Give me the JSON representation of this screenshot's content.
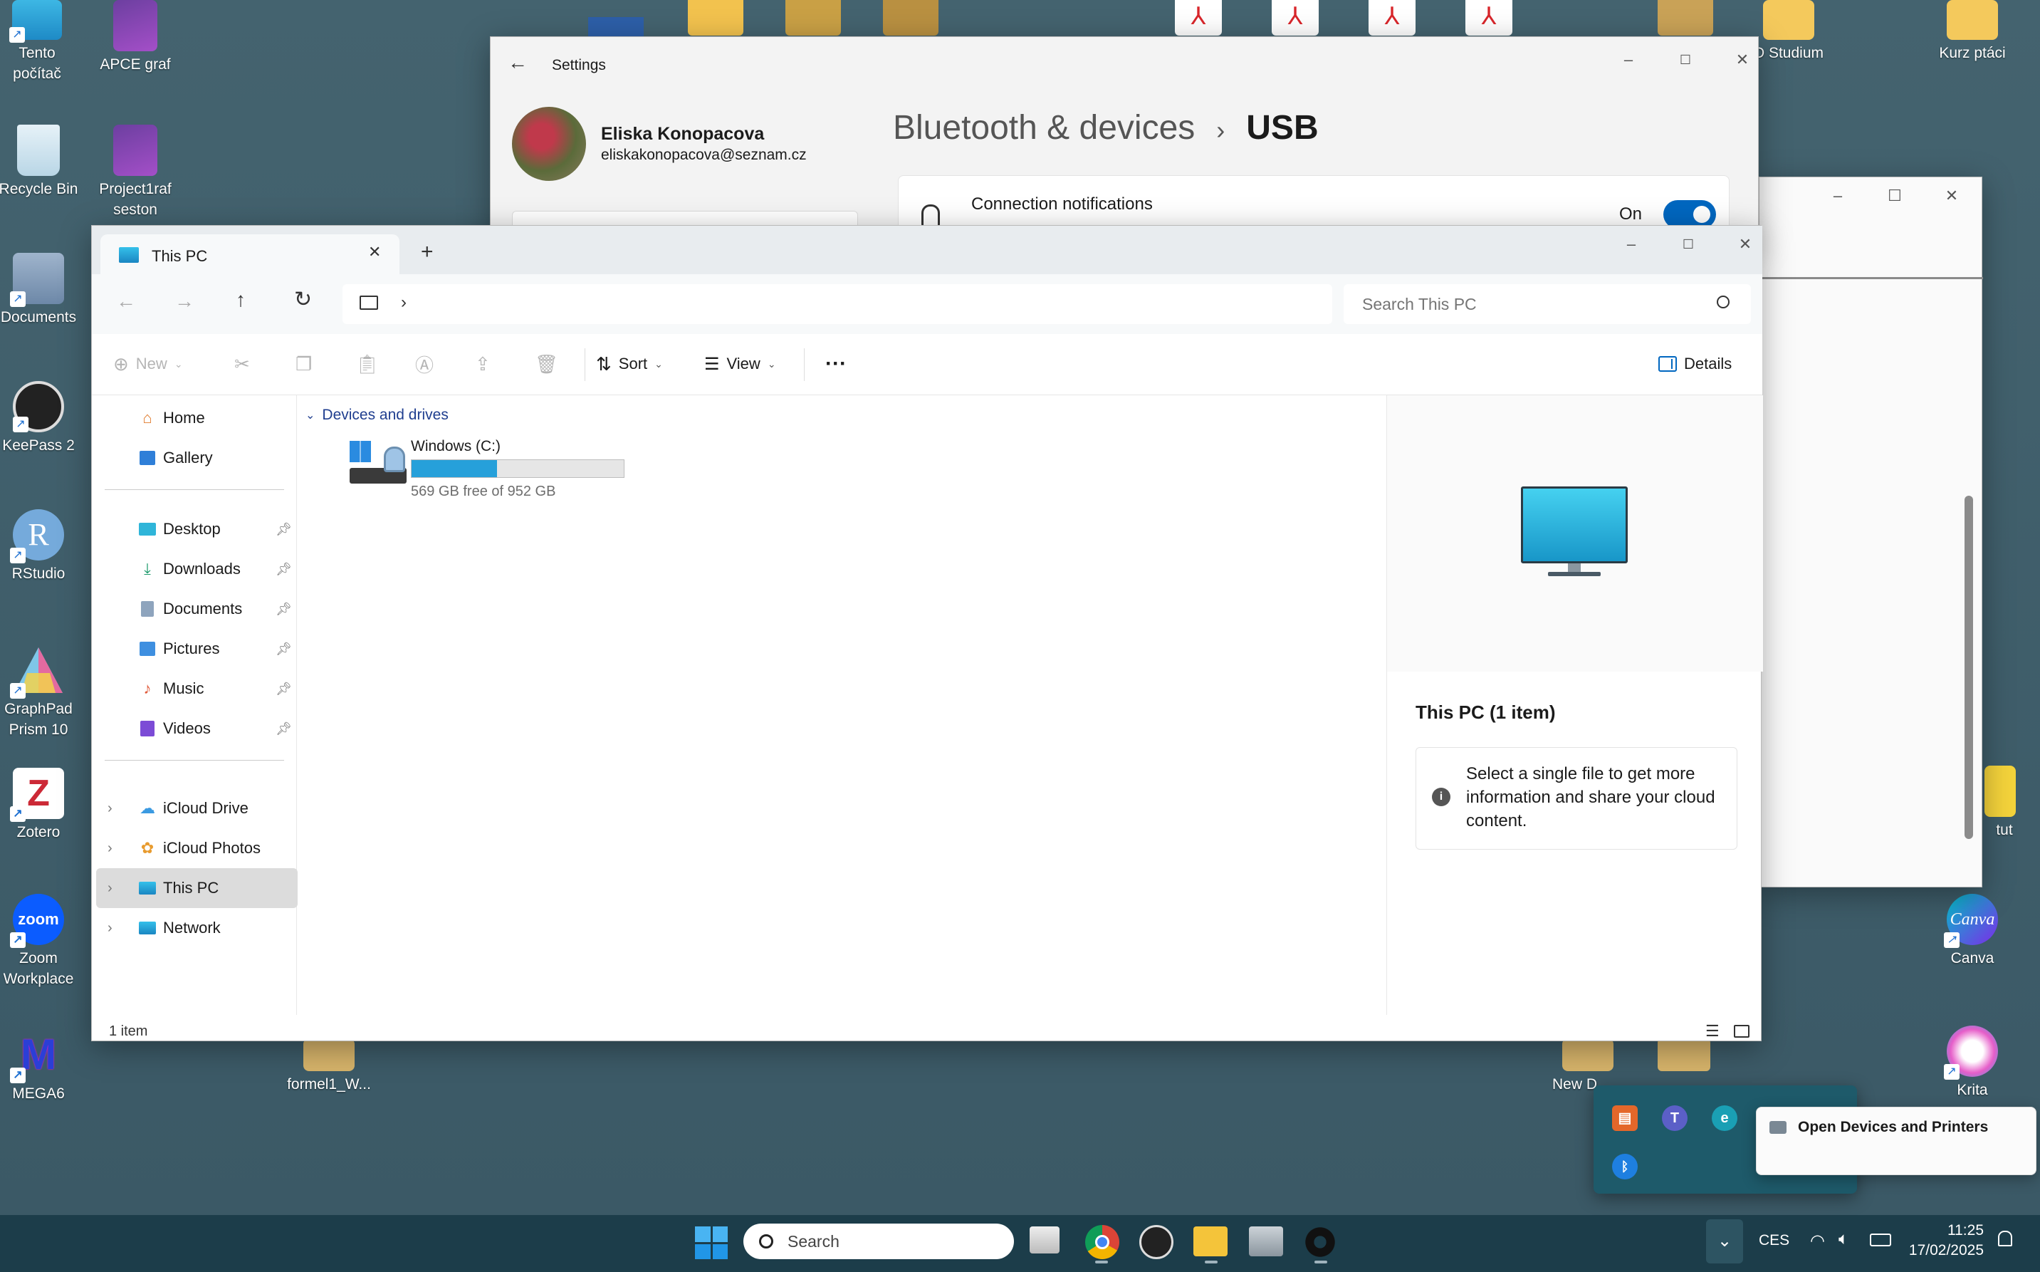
{
  "desktop": {
    "icons_left": [
      {
        "label": "Tento počítač",
        "icon": "this-pc-icon"
      },
      {
        "label": "APCE graf",
        "icon": "prism-file-icon"
      },
      {
        "label": "Recycle Bin",
        "icon": "recycle-bin-icon"
      },
      {
        "label": "Project1raf seston",
        "icon": "prism-file-icon"
      },
      {
        "label": "Documents",
        "icon": "documents-folder-icon"
      },
      {
        "label": "KeePass 2",
        "icon": "keepass-icon"
      },
      {
        "label": "RStudio",
        "icon": "rstudio-icon"
      },
      {
        "label": "GraphPad Prism 10",
        "icon": "prism-app-icon"
      },
      {
        "label": "Zotero",
        "icon": "zotero-icon"
      },
      {
        "label": "Zoom Workplace",
        "icon": "zoom-icon"
      },
      {
        "label": "MEGA6",
        "icon": "mega-icon"
      },
      {
        "label": "formel1_W...",
        "icon": "folder-icon"
      }
    ],
    "icons_right": [
      {
        "label": "D Studium",
        "icon": "folder-icon"
      },
      {
        "label": "Kurz ptáci",
        "icon": "folder-icon"
      },
      {
        "label": "Canva",
        "icon": "canva-icon"
      },
      {
        "label": "Krita",
        "icon": "krita-icon"
      },
      {
        "label": "New D",
        "icon": "folder-icon"
      },
      {
        "label": "tut",
        "icon": "app-icon"
      }
    ],
    "rstudio_letter": "R",
    "zoom_text": "zoom",
    "canva_text": "Canva",
    "zotero_letter": "Z",
    "mega_letter": "M"
  },
  "settings": {
    "title": "Settings",
    "user_name": "Eliska Konopacova",
    "user_email": "eliskakonopacova@seznam.cz",
    "breadcrumb_parent": "Bluetooth & devices",
    "breadcrumb_sep": "›",
    "breadcrumb_current": "USB",
    "row_label": "Connection notifications",
    "toggle_state": "On"
  },
  "explorer": {
    "tab_title": "This PC",
    "new_tab": "+",
    "search_placeholder": "Search This PC",
    "address_sep": "›",
    "toolbar": {
      "new_label": "New",
      "sort_label": "Sort",
      "view_label": "View",
      "more_label": "···",
      "details_label": "Details"
    },
    "nav": {
      "home": "Home",
      "gallery": "Gallery",
      "pinned": [
        "Desktop",
        "Downloads",
        "Documents",
        "Pictures",
        "Music",
        "Videos"
      ],
      "cloud": [
        "iCloud Drive",
        "iCloud Photos"
      ],
      "this_pc": "This PC",
      "network": "Network"
    },
    "section_header": "Devices and drives",
    "drive": {
      "name": "Windows (C:)",
      "free_text": "569 GB free of 952 GB",
      "used_fraction": 0.402
    },
    "details": {
      "title": "This PC (1 item)",
      "info": "Select a single file to get more information and share your cloud content."
    },
    "status": "1 item"
  },
  "popup": {
    "menu_item": "Open Devices and Printers"
  },
  "taskbar": {
    "search_placeholder": "Search",
    "language": "CES",
    "time": "11:25",
    "date": "17/02/2025"
  },
  "colors": {
    "accent": "#0067c0",
    "drive_bar": "#26a0da",
    "desktop_bg": "#3f5f6d",
    "taskbar_bg": "#1c3d4a"
  }
}
